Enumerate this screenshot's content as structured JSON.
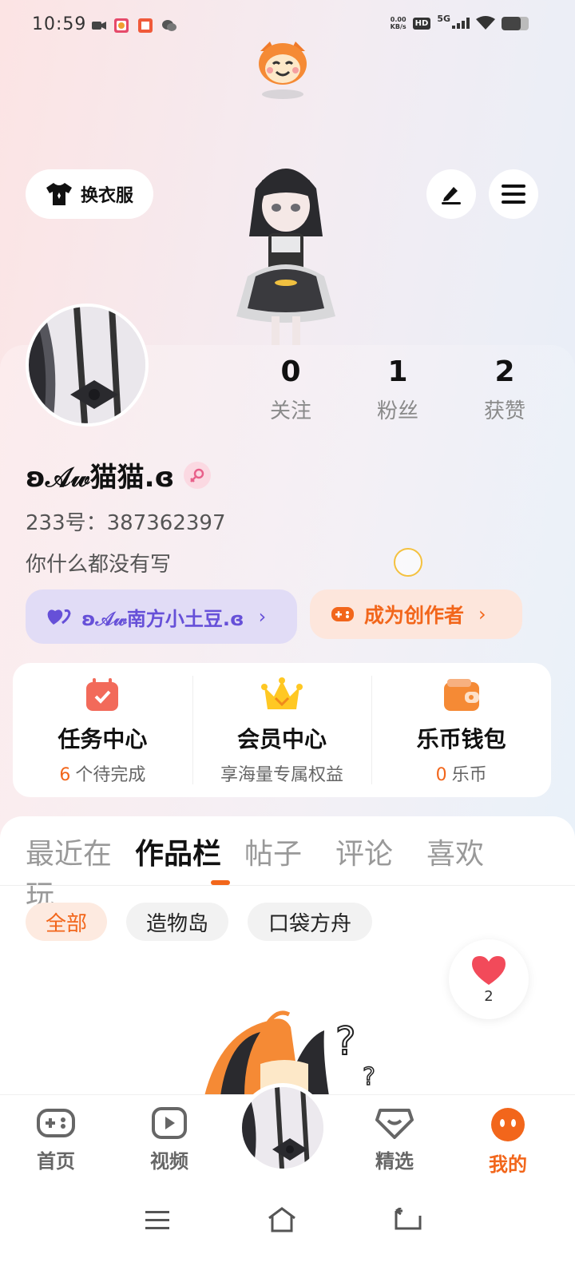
{
  "status_bar": {
    "time": "10:59",
    "net_speed_value": "0.00",
    "net_speed_unit": "KB/s",
    "hd": "HD",
    "network": "5G",
    "battery_level": 0.7
  },
  "header": {
    "outfit_label": "换衣服",
    "edit_icon": "pen-icon",
    "menu_icon": "hamburger-menu-icon"
  },
  "profile": {
    "stats": [
      {
        "value": "0",
        "label": "关注"
      },
      {
        "value": "1",
        "label": "粉丝"
      },
      {
        "value": "2",
        "label": "获赞"
      }
    ],
    "nickname": "ʚ𝒜𝓌猫猫.ɞ",
    "gender": "female",
    "uid": "233号：387362397",
    "bio": "你什么都没有写",
    "partner_label": "ʚ𝒜𝓌南方小土豆.ɞ",
    "creator_label": "成为创作者",
    "chevron": "›"
  },
  "quick": [
    {
      "title": "任务中心",
      "count": "6",
      "sub": "个待完成",
      "icon": "task-calendar-icon"
    },
    {
      "title": "会员中心",
      "count": "",
      "sub": "享海量专属权益",
      "icon": "crown-icon"
    },
    {
      "title": "乐币钱包",
      "count": "0",
      "sub": "乐币",
      "icon": "wallet-icon"
    }
  ],
  "tabs": [
    "最近在玩",
    "作品栏",
    "帖子",
    "评论",
    "喜欢"
  ],
  "active_tab": "作品栏",
  "filters": [
    "全部",
    "造物岛",
    "口袋方舟"
  ],
  "active_filter": "全部",
  "like_fab": {
    "count": "2"
  },
  "bottom_nav": [
    {
      "label": "首页",
      "icon": "gamepad-icon"
    },
    {
      "label": "视频",
      "icon": "play-icon"
    },
    {
      "label": "精选",
      "icon": "heart-diamond-icon"
    },
    {
      "label": "我的",
      "icon": "face-icon"
    }
  ],
  "colors": {
    "accent": "#f2661b",
    "partner": "#6650d8"
  }
}
